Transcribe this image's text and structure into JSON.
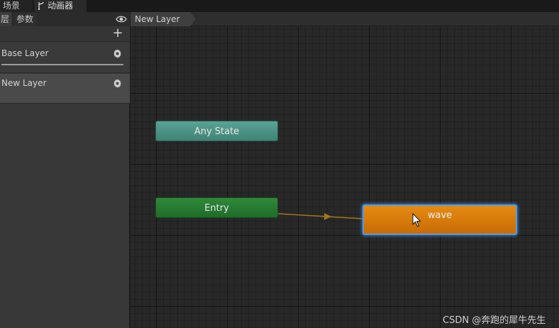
{
  "top_tabs": [
    {
      "label": "场景"
    },
    {
      "label": "动画器",
      "icon": "branch-icon"
    }
  ],
  "sidebar": {
    "tabs": [
      {
        "label": "层"
      },
      {
        "label": "参数"
      }
    ],
    "visibility_icon": "eye-icon",
    "add_icon": "plus-icon",
    "add_glyph": "+",
    "layers": [
      {
        "label": "Base Layer",
        "settings_icon": "gear-icon"
      },
      {
        "label": "New Layer",
        "settings_icon": "gear-icon"
      }
    ]
  },
  "graph": {
    "breadcrumb": "New Layer",
    "nodes": {
      "any_state": {
        "label": "Any State",
        "color": "#4e9588"
      },
      "entry": {
        "label": "Entry",
        "color": "#287d33"
      },
      "wave": {
        "label": "wave",
        "color": "#d97b0a",
        "selected": true
      }
    },
    "transition_color": "#a07818"
  },
  "watermark": "CSDN @奔跑的犀牛先生"
}
